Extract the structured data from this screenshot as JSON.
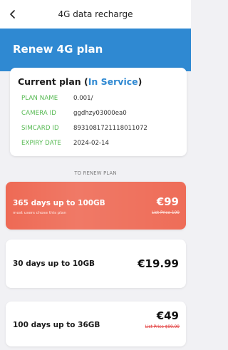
{
  "header": {
    "title": "4G data recharge"
  },
  "hero": {
    "title": "Renew 4G plan",
    "color": "#2f89d2"
  },
  "current_plan": {
    "title_prefix": "Current plan (",
    "status": "In Service",
    "title_suffix": ")",
    "rows": [
      {
        "label": "PLAN NAME",
        "value": "0.001/"
      },
      {
        "label": "CAMERA ID",
        "value": "ggdhzy03000ea0"
      },
      {
        "label": "SIMCARD ID",
        "value": "8931081721118011072"
      },
      {
        "label": "EXPIRY DATE",
        "value": "2024-02-14"
      }
    ]
  },
  "renew_section_label": "TO RENEW PLAN",
  "plans": [
    {
      "name": "365 days up to 100GB",
      "subtitle": "most users chose this plan",
      "price": "€99",
      "list_price": "List Price 199",
      "featured": true,
      "accent": "#ee6a55"
    },
    {
      "name": "30 days up to 10GB",
      "price": "€19.99",
      "featured": false
    },
    {
      "name": "100 days up to 36GB",
      "price": "€49",
      "list_price": "List Price $99.99",
      "featured": false
    }
  ],
  "icons": {
    "back": "chevron-left-icon"
  }
}
